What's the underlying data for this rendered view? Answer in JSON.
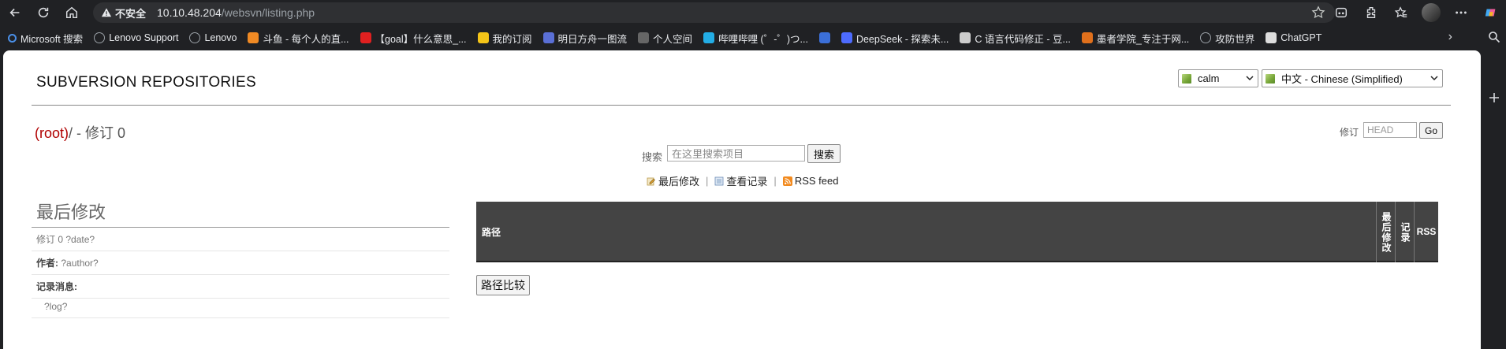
{
  "browser": {
    "security_warning": "不安全",
    "url_host": "10.10.48.204",
    "url_path": "/websvn/listing.php",
    "bookmarks": [
      {
        "label": "Microsoft 搜索",
        "icon": "search-icon",
        "color": "#4a8fe7"
      },
      {
        "label": "Lenovo Support",
        "icon": "globe-icon",
        "color": "#9aa0a6"
      },
      {
        "label": "Lenovo",
        "icon": "globe-icon",
        "color": "#9aa0a6"
      },
      {
        "label": "斗鱼 - 每个人的直...",
        "icon": "douyu-icon",
        "color": "#f08a24"
      },
      {
        "label": "【goal】什么意思_...",
        "icon": "y-icon",
        "color": "#e02020"
      },
      {
        "label": "我的订阅",
        "icon": "smiley-icon",
        "color": "#f5c518"
      },
      {
        "label": "明日方舟一图流",
        "icon": "one-icon",
        "color": "#5a6fd6"
      },
      {
        "label": "个人空间",
        "icon": "github-icon",
        "color": "#666666"
      },
      {
        "label": "哔哩哔哩 (゜-゜)つ...",
        "icon": "bilibili-icon",
        "color": "#23ade5"
      },
      {
        "label": "",
        "icon": "cap-icon",
        "color": "#3b6fd8"
      },
      {
        "label": "DeepSeek - 探索未...",
        "icon": "deepseek-icon",
        "color": "#4d6bfe"
      },
      {
        "label": "C 语言代码修正 - 豆...",
        "icon": "doubao-icon",
        "color": "#cccccc"
      },
      {
        "label": "墨者学院_专注于网...",
        "icon": "mozhe-icon",
        "color": "#e0701c"
      },
      {
        "label": "攻防世界",
        "icon": "globe-icon",
        "color": "#9aa0a6"
      },
      {
        "label": "ChatGPT",
        "icon": "openai-icon",
        "color": "#dddddd"
      }
    ]
  },
  "page": {
    "repo_title": "SUBVERSION REPOSITORIES",
    "repo_select": "calm",
    "lang_select": "中文 - Chinese (Simplified)",
    "path_root": "(root)",
    "path_rest": "/ - 修订 0",
    "rev_label": "修订",
    "rev_placeholder": "HEAD",
    "go_label": "Go",
    "search_label": "搜索",
    "search_placeholder": "在这里搜索项目",
    "search_button": "搜索",
    "links": {
      "last_modified": "最后修改",
      "view_log": "查看记录",
      "rss": "RSS feed"
    },
    "side": {
      "title": "最后修改",
      "revision": "修订 0 ?date?",
      "author_label": "作者:",
      "author_value": "?author?",
      "log_label": "记录消息:",
      "log_value": "?log?"
    },
    "table": {
      "col_path": "路径",
      "col_last_mod": "最后修改",
      "col_log": "记录",
      "col_rss": "RSS"
    },
    "compare_button": "路径比较"
  }
}
